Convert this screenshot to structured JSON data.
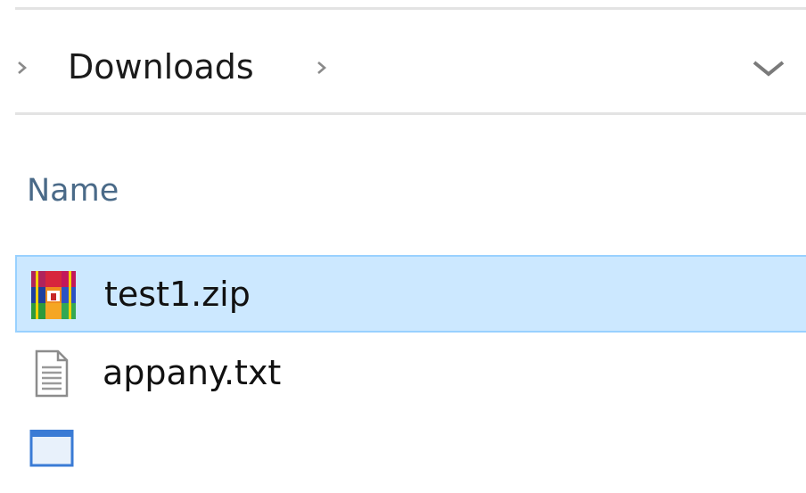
{
  "breadcrumb": {
    "folder": "Downloads",
    "separator_icon": "chevron-right-icon",
    "dropdown_icon": "chevron-down-icon"
  },
  "columns": {
    "name": "Name"
  },
  "files": [
    {
      "name": "test1.zip",
      "icon": "winrar-archive-icon",
      "selected": true
    },
    {
      "name": "appany.txt",
      "icon": "text-document-icon",
      "selected": false
    },
    {
      "name": "",
      "icon": "application-window-icon",
      "selected": false
    }
  ],
  "colors": {
    "selection_fill": "#cce8ff",
    "selection_border": "#99d1ff",
    "header_text": "#4a6a88"
  }
}
